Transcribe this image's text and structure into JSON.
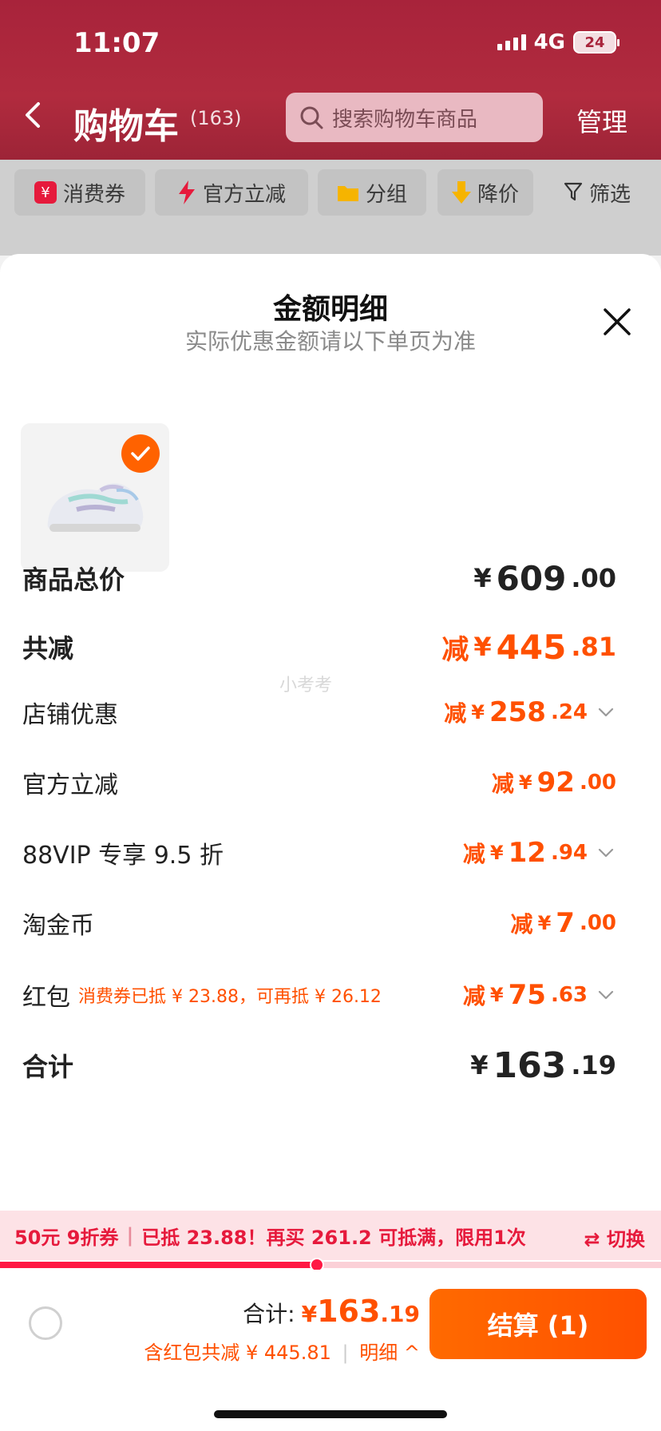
{
  "status_bar": {
    "time": "11:07",
    "network": "4G",
    "battery": "24"
  },
  "header": {
    "back_icon": "chevron-left-icon",
    "title": "购物车",
    "count": "(163)",
    "search_placeholder": "搜索购物车商品",
    "manage_label": "管理"
  },
  "filters": [
    {
      "label": "消费券",
      "icon": "coupon-icon",
      "color": "#e61a3c"
    },
    {
      "label": "官方立减",
      "icon": "lightning-icon",
      "color": "#e61a3c"
    },
    {
      "label": "分组",
      "icon": "folder-icon",
      "color": "#f6b400"
    },
    {
      "label": "降价",
      "icon": "price-down-icon",
      "color": "#f6b400"
    },
    {
      "label": "筛选",
      "icon": "funnel-icon",
      "color": "#333333"
    }
  ],
  "sheet": {
    "title": "金额明细",
    "subtitle": "实际优惠金额请以下单页为准",
    "watermark": "小考考",
    "product_selected": true,
    "rows": {
      "total_price": {
        "label": "商品总价",
        "cur": "¥",
        "int": "609",
        "dec": ".00"
      },
      "total_reduce": {
        "label": "共减",
        "prefix": "减",
        "cur": "¥",
        "int": "445",
        "dec": ".81"
      },
      "shop_discount": {
        "label": "店铺优惠",
        "prefix": "减",
        "cur": "¥",
        "int": "258",
        "dec": ".24"
      },
      "official_cut": {
        "label": "官方立减",
        "prefix": "减",
        "cur": "¥",
        "int": "92",
        "dec": ".00"
      },
      "vip": {
        "label": "88VIP 专享 9.5 折",
        "prefix": "减",
        "cur": "¥",
        "int": "12",
        "dec": ".94"
      },
      "gold_coin": {
        "label": "淘金币",
        "prefix": "减",
        "cur": "¥",
        "int": "7",
        "dec": ".00"
      },
      "red_packet": {
        "label": "红包",
        "note": "消费券已抵 ¥ 23.88，可再抵 ¥ 26.12",
        "prefix": "减",
        "cur": "¥",
        "int": "75",
        "dec": ".63"
      },
      "sum": {
        "label": "合计",
        "cur": "¥",
        "int": "163",
        "dec": ".19"
      }
    }
  },
  "promo": {
    "coupon": "50元 9折券",
    "detail": "已抵 23.88！再买 261.2 可抵满，限用1次",
    "switch_label": "⇄ 切换",
    "progress": 0.48
  },
  "bottom": {
    "total_label": "合计:",
    "total_cur": "¥",
    "total_int": "163",
    "total_dec": ".19",
    "sub_text": "含红包共减 ¥ 445.81",
    "detail_label": "明细 ^",
    "checkout_label": "结算 (1)"
  },
  "colors": {
    "accent": "#ff5000",
    "header": "#a8233b",
    "promo_text": "#e61a3c"
  }
}
